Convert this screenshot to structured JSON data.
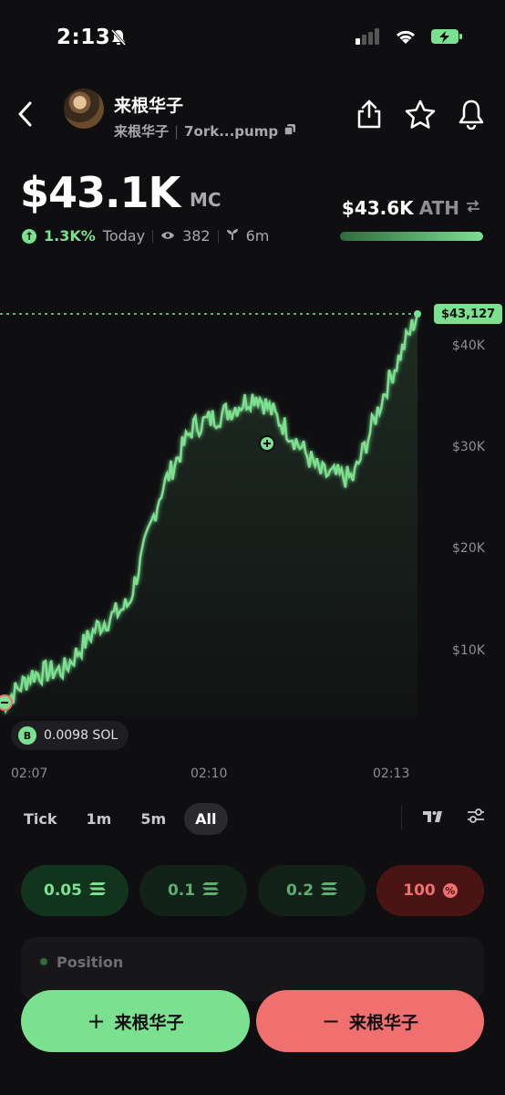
{
  "status_bar": {
    "time": "2:13"
  },
  "header": {
    "token_name": "来根华子",
    "token_symbol": "来根华子",
    "contract": "7ork...pump"
  },
  "market": {
    "market_cap": "$43.1K",
    "market_cap_unit": "MC",
    "change_pct": "1.3K%",
    "change_period": "Today",
    "views": "382",
    "age": "6m",
    "ath_value": "$43.6K",
    "ath_label": "ATH",
    "ath_progress": 0.99
  },
  "chart": {
    "last_price_label": "$43,127",
    "y_ticks": [
      "$40K",
      "$30K",
      "$20K",
      "$10K"
    ],
    "x_ticks": [
      "02:07",
      "02:10",
      "02:13"
    ],
    "trade_badge": {
      "side": "B",
      "amount": "0.0098 SOL"
    }
  },
  "chart_data": {
    "type": "line",
    "x": [
      "02:07",
      "02:08",
      "02:09",
      "02:10",
      "02:11",
      "02:12",
      "02:13"
    ],
    "series": [
      {
        "values": [
          1000,
          4500,
          5000,
          9500,
          12000,
          24000,
          31000,
          32500,
          34500,
          30500,
          26000,
          25500,
          35000,
          43127
        ]
      }
    ],
    "ylim": [
      0,
      45000
    ],
    "grid": false,
    "colors": {
      "line": "#7be08f"
    }
  },
  "timeframes": [
    {
      "label": "Tick",
      "active": false
    },
    {
      "label": "1m",
      "active": false
    },
    {
      "label": "5m",
      "active": false
    },
    {
      "label": "All",
      "active": true
    }
  ],
  "quick_buy": [
    {
      "label": "0.05"
    },
    {
      "label": "0.1"
    },
    {
      "label": "0.2"
    },
    {
      "label": "100"
    }
  ],
  "position": {
    "label": "Position"
  },
  "actions": {
    "buy_label": "来根华子",
    "sell_label": "来根华子"
  }
}
